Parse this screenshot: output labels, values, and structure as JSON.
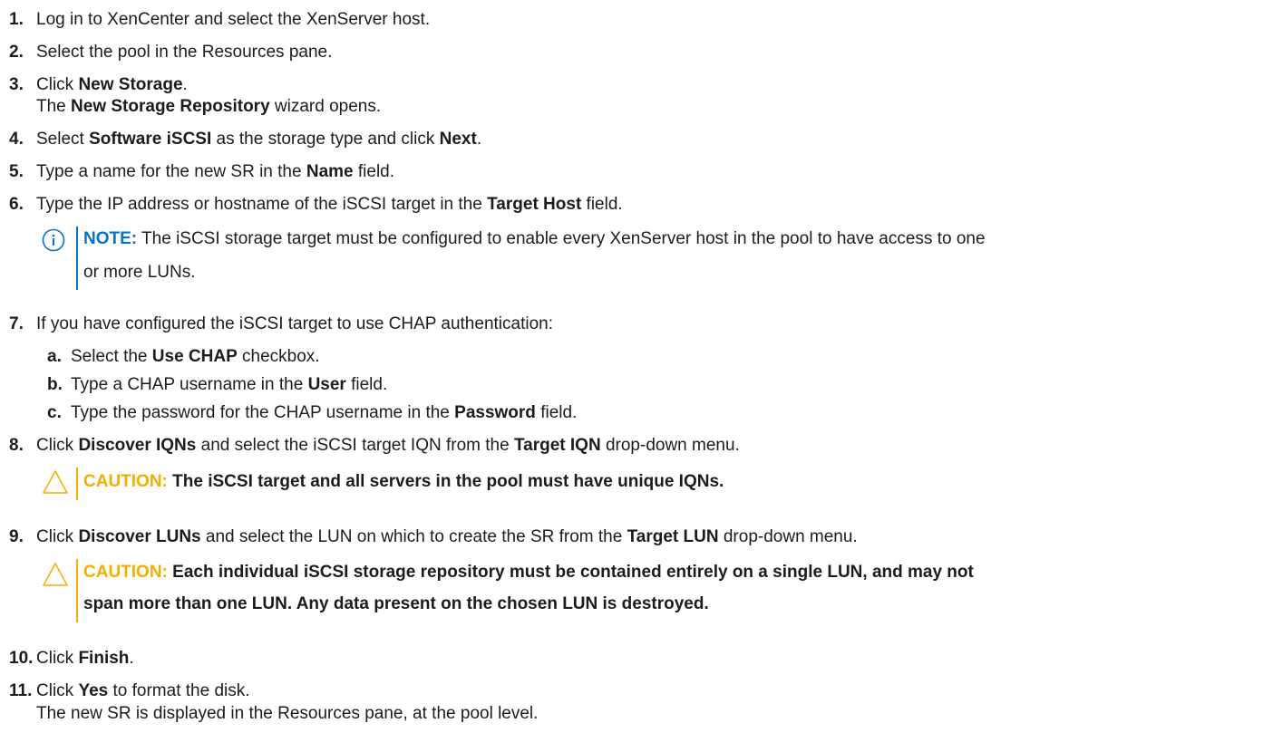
{
  "steps": [
    {
      "num": "1.",
      "text": "Log in to XenCenter and select the XenServer host."
    },
    {
      "num": "2.",
      "text": "Select the pool in the Resources pane."
    },
    {
      "num": "3.",
      "pre": "Click ",
      "bold": "New Storage",
      "post": ".",
      "sub_pre": "The ",
      "sub_bold": "New Storage Repository",
      "sub_post": " wizard opens."
    },
    {
      "num": "4.",
      "pre": "Select ",
      "bold": "Software iSCSI",
      "mid": " as the storage type and click ",
      "bold2": "Next",
      "post": "."
    },
    {
      "num": "5.",
      "pre": "Type a name for the new SR in the ",
      "bold": "Name",
      "post": " field."
    },
    {
      "num": "6.",
      "pre": "Type the IP address or hostname of the iSCSI target in the ",
      "bold": "Target Host",
      "post": " field."
    },
    {
      "num": "7.",
      "text": "If you have configured the iSCSI target to use CHAP authentication:"
    },
    {
      "num": "8.",
      "pre": "Click ",
      "bold": "Discover IQNs",
      "mid": " and select the iSCSI target IQN from the ",
      "bold2": "Target IQN",
      "post": " drop-down menu."
    },
    {
      "num": "9.",
      "pre": "Click ",
      "bold": "Discover LUNs",
      "mid": " and select the LUN on which to create the SR from the ",
      "bold2": "Target LUN",
      "post": " drop-down menu."
    },
    {
      "num": "10.",
      "pre": "Click ",
      "bold": "Finish",
      "post": "."
    },
    {
      "num": "11.",
      "pre": "Click ",
      "bold": "Yes",
      "post": " to format the disk.",
      "sub": "The new SR is displayed in the Resources pane, at the pool level."
    }
  ],
  "substeps": [
    {
      "letter": "a.",
      "pre": "Select the ",
      "bold": "Use CHAP",
      "post": " checkbox."
    },
    {
      "letter": "b.",
      "pre": "Type a CHAP username in the ",
      "bold": "User",
      "post": " field."
    },
    {
      "letter": "c.",
      "pre": "Type the password for the CHAP username in the ",
      "bold": "Password",
      "post": " field."
    }
  ],
  "note": {
    "label": "NOTE:",
    "line1": " The iSCSI storage target must be configured to enable every XenServer host in the pool to have access to one",
    "line2": "or more LUNs."
  },
  "caution1": {
    "label": "CAUTION:",
    "text": " The iSCSI target and all servers in the pool must have unique IQNs."
  },
  "caution2": {
    "label": "CAUTION:",
    "line1": " Each individual iSCSI storage repository must be contained entirely on a single LUN, and may not",
    "line2": "span more than one LUN. Any data present on the chosen LUN is destroyed."
  },
  "colors": {
    "note_accent": "#0672cb",
    "caution_accent": "#f2af00",
    "text": "#1c1c1c"
  },
  "icons": {
    "note": "info-circle-icon",
    "caution": "warning-triangle-icon"
  }
}
